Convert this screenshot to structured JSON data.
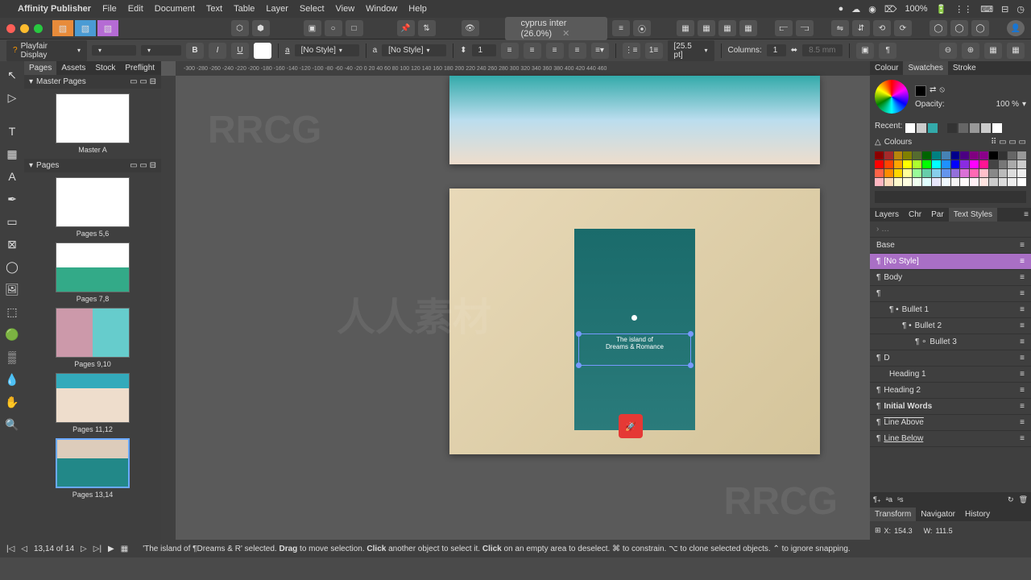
{
  "menubar": {
    "app": "Affinity Publisher",
    "items": [
      "File",
      "Edit",
      "Document",
      "Text",
      "Table",
      "Layer",
      "Select",
      "View",
      "Window",
      "Help"
    ],
    "battery": "100%"
  },
  "document": {
    "title": "cyprus inter (26.0%)"
  },
  "context": {
    "font": "Playfair Display",
    "para_style": "[No Style]",
    "char_style": "[No Style]",
    "linespacing": "[25.5 pt]",
    "columns_label": "Columns:",
    "columns_value": "1",
    "gutter": "8.5 mm"
  },
  "left_panel": {
    "tabs": [
      "Pages",
      "Assets",
      "Stock",
      "Preflight"
    ],
    "master_header": "Master Pages",
    "masters": [
      {
        "label": "Master A"
      }
    ],
    "pages_header": "Pages",
    "pages": [
      {
        "label": "Pages 5,6"
      },
      {
        "label": "Pages 7,8"
      },
      {
        "label": "Pages 9,10"
      },
      {
        "label": "Pages 11,12"
      },
      {
        "label": "Pages 13,14",
        "selected": true
      }
    ]
  },
  "canvas": {
    "text_line1": "The island of",
    "text_line2": "Dreams & Romance"
  },
  "right_panel": {
    "color_tabs": [
      "Colour",
      "Swatches",
      "Stroke"
    ],
    "opacity_label": "Opacity:",
    "opacity_value": "100 %",
    "recent_label": "Recent:",
    "colours_label": "Colours",
    "style_tabs": [
      "Layers",
      "Chr",
      "Par",
      "Text Styles"
    ],
    "styles": [
      {
        "name": "Base",
        "type": "para"
      },
      {
        "name": "[No Style]",
        "type": "para",
        "selected": true
      },
      {
        "name": "Body",
        "type": "para"
      },
      {
        "name": "",
        "type": "para"
      },
      {
        "name": "Bullet 1",
        "type": "para",
        "indent": 1
      },
      {
        "name": "Bullet 2",
        "type": "para",
        "indent": 2
      },
      {
        "name": "Bullet 3",
        "type": "para",
        "indent": 3
      },
      {
        "name": "D",
        "type": "para"
      },
      {
        "name": "Heading 1",
        "type": "para",
        "indent": 1
      },
      {
        "name": "Heading 2",
        "type": "para"
      },
      {
        "name": "Initial Words",
        "type": "char"
      },
      {
        "name": "Line Above",
        "type": "para"
      },
      {
        "name": "Line Below",
        "type": "para"
      }
    ],
    "transform_tabs": [
      "Transform",
      "Navigator",
      "History"
    ],
    "transform": {
      "x": "154.3",
      "w": "111.5"
    }
  },
  "status": {
    "page_indicator": "13,14 of 14",
    "hint_prefix": "'The island of ¶Dreams & R' selected.",
    "hint_drag": "Drag",
    "hint_drag_txt": " to move selection. ",
    "hint_click": "Click",
    "hint_click_txt": " another object to select it. ",
    "hint_click2": "Click",
    "hint_click2_txt": " on an empty area to deselect. ⌘ to constrain. ⌥ to clone selected objects. ⌃ to ignore snapping."
  }
}
